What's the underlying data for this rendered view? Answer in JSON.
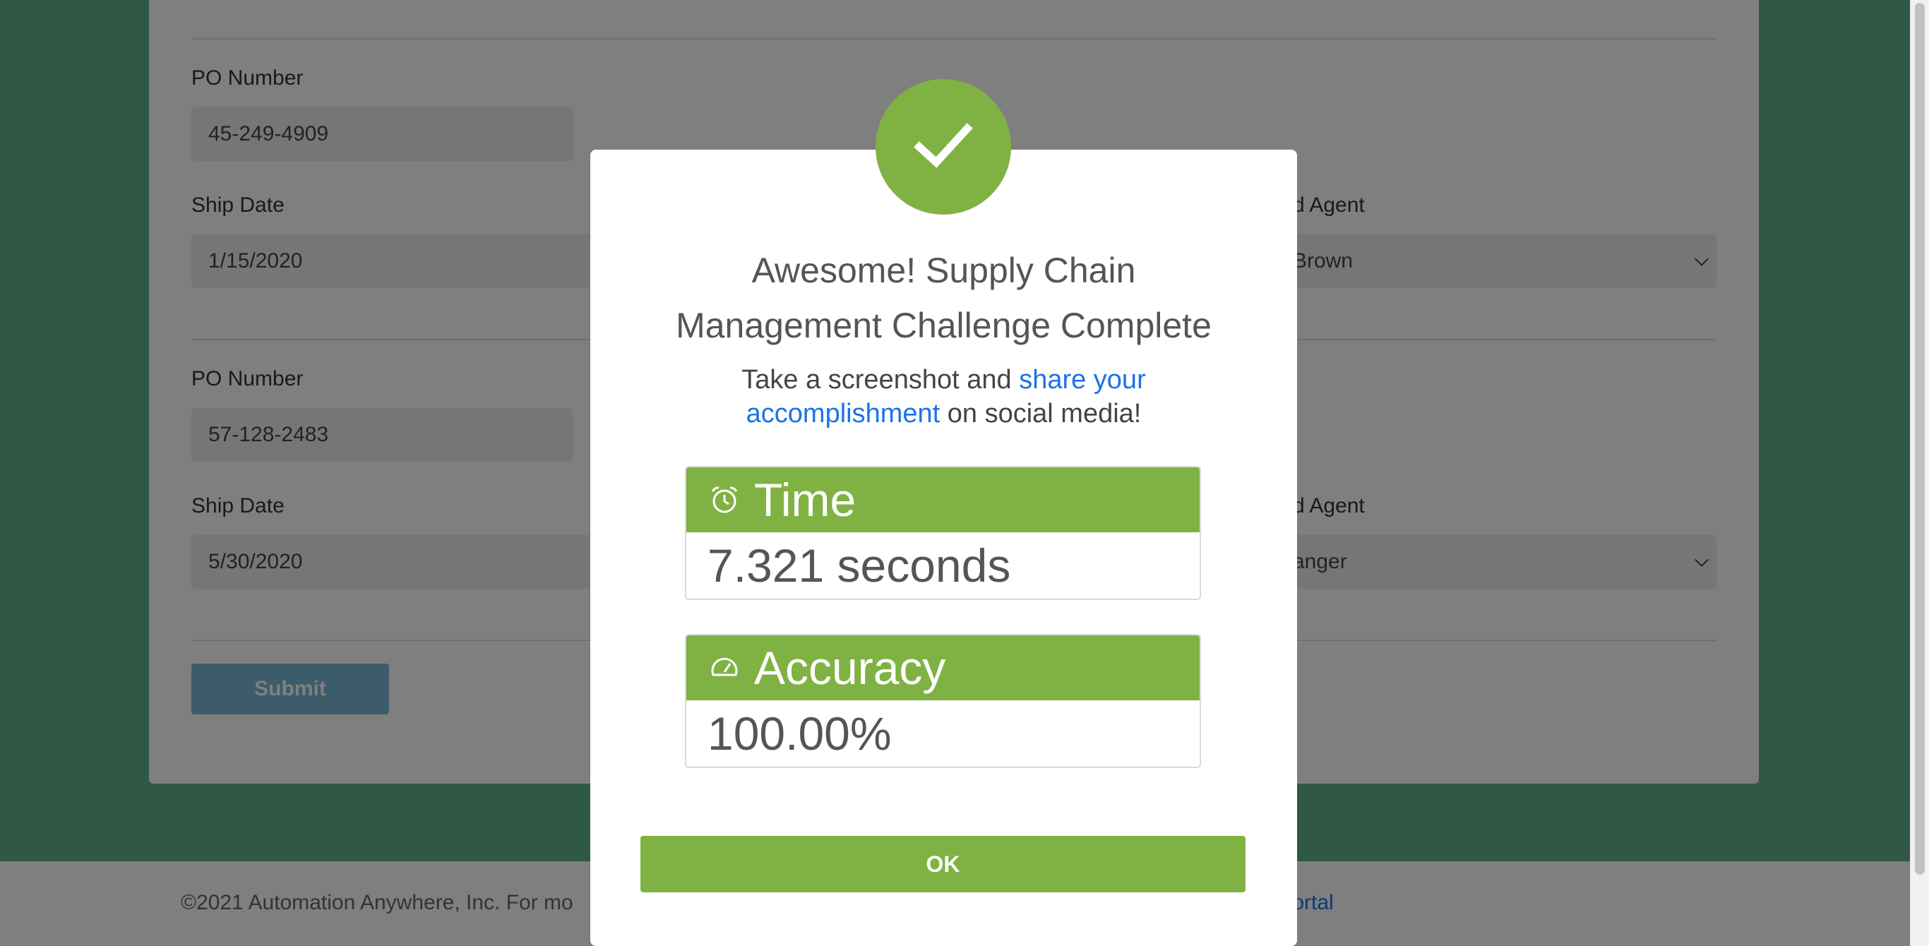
{
  "form": {
    "rows": [
      {
        "po_label": "PO Number",
        "po_value": "45-249-4909",
        "ship_label": "Ship Date",
        "ship_value": "1/15/2020",
        "agent_label": "d Agent",
        "agent_value": "Brown"
      },
      {
        "po_label": "PO Number",
        "po_value": "57-128-2483",
        "ship_label": "Ship Date",
        "ship_value": "5/30/2020",
        "agent_label": "d Agent",
        "agent_value": "anger"
      }
    ],
    "submit_label": "Submit"
  },
  "footer": {
    "text": "©2021 Automation Anywhere, Inc. For mo",
    "portal_link": "r Portal"
  },
  "modal": {
    "title_line1": "Awesome! Supply Chain",
    "title_line2": "Management Challenge Complete",
    "sub_pre": "Take a screenshot and ",
    "sub_link_1": "share your",
    "sub_link_2": "accomplishment",
    "sub_post": " on social media!",
    "time_label": "Time",
    "time_value": "7.321 seconds",
    "accuracy_label": "Accuracy",
    "accuracy_value": "100.00%",
    "ok_label": "OK"
  },
  "colors": {
    "accent_green": "#80b243",
    "page_green": "#5fb38a",
    "link_blue": "#1a73e8"
  },
  "icons": {
    "check": "checkmark-icon",
    "time": "alarm-clock-icon",
    "accuracy": "gauge-icon"
  }
}
